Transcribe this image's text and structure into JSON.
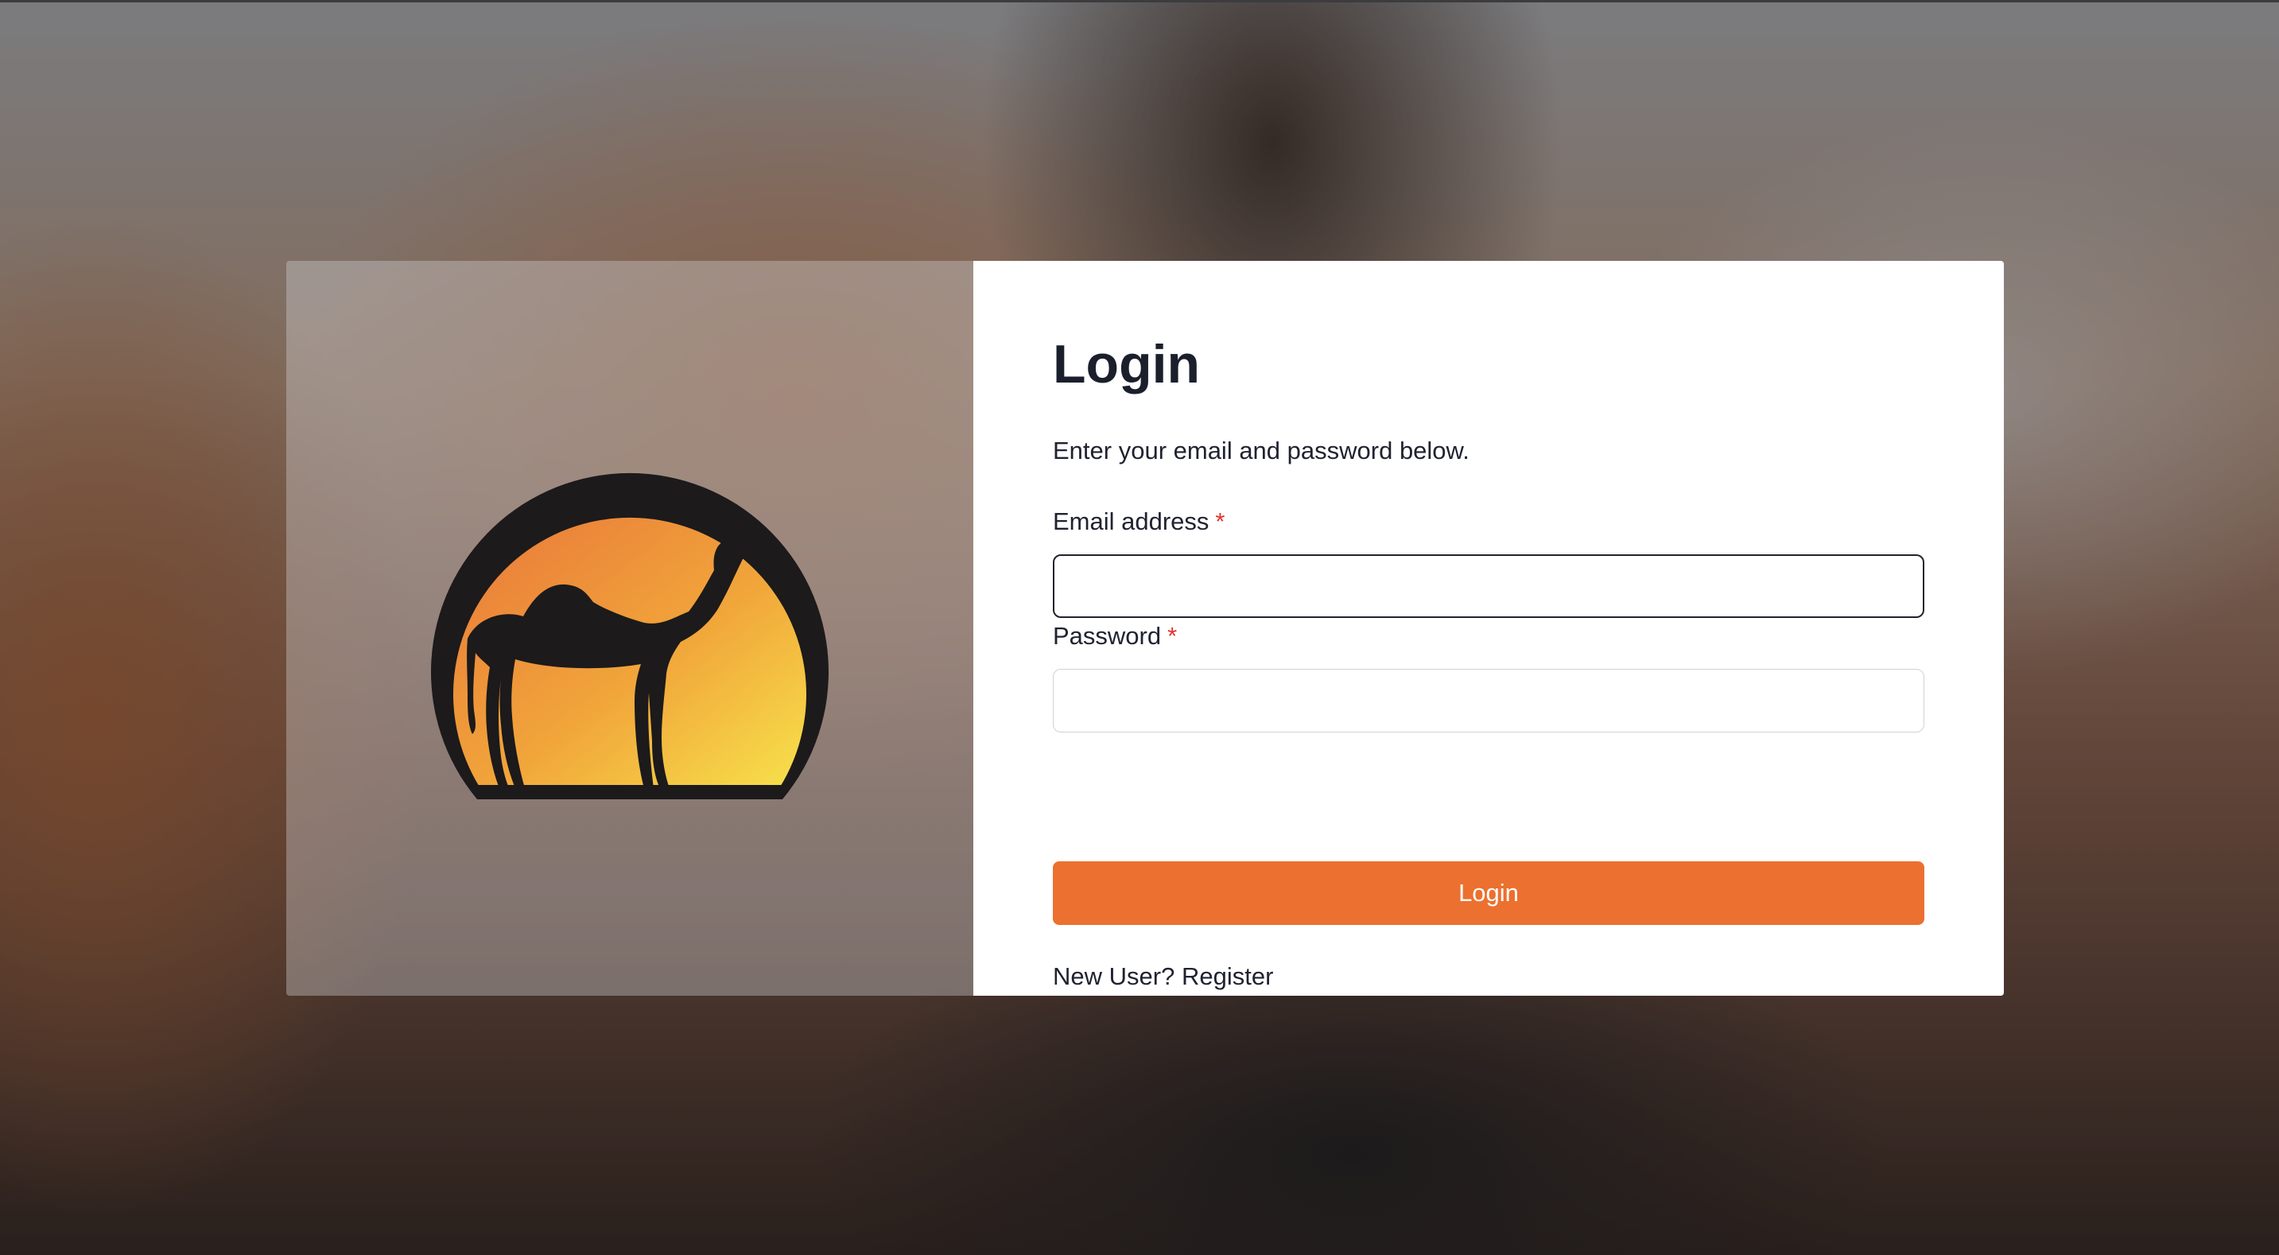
{
  "background": {
    "description_icon": "photo-background"
  },
  "brand": {
    "logo_icon": "camel-sunset-logo",
    "accent_color": "#ec702f"
  },
  "login": {
    "title": "Login",
    "subtitle": "Enter your email and password below.",
    "email_label": "Email address",
    "email_required_mark": "*",
    "email_value": "",
    "password_label": "Password",
    "password_required_mark": "*",
    "password_value": "",
    "submit_label": "Login",
    "register_prompt": "New User?",
    "register_link": "Register"
  },
  "colors": {
    "title": "#1b1f2b",
    "required": "#e0322f",
    "button": "#ec702f",
    "button_text": "#ffffff"
  }
}
